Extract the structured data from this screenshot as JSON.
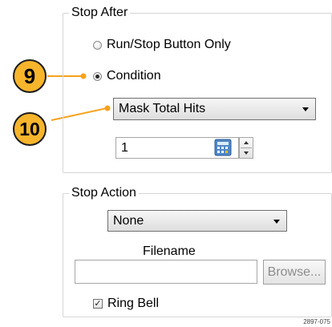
{
  "stop_after": {
    "legend": "Stop After",
    "options": [
      {
        "label": "Run/Stop Button Only",
        "checked": false
      },
      {
        "label": "Condition",
        "checked": true
      }
    ],
    "condition_select": "Mask Total Hits",
    "count_value": "1"
  },
  "stop_action": {
    "legend": "Stop Action",
    "action_select": "None",
    "filename_label": "Filename",
    "filename_value": "",
    "browse_label": "Browse...",
    "ring_bell_label": "Ring Bell",
    "ring_bell_checked": true
  },
  "callouts": [
    "9",
    "10"
  ],
  "figure_id": "2897-075",
  "colors": {
    "callout_fill": "#f7b52c",
    "leader_line": "#f7a21b"
  }
}
